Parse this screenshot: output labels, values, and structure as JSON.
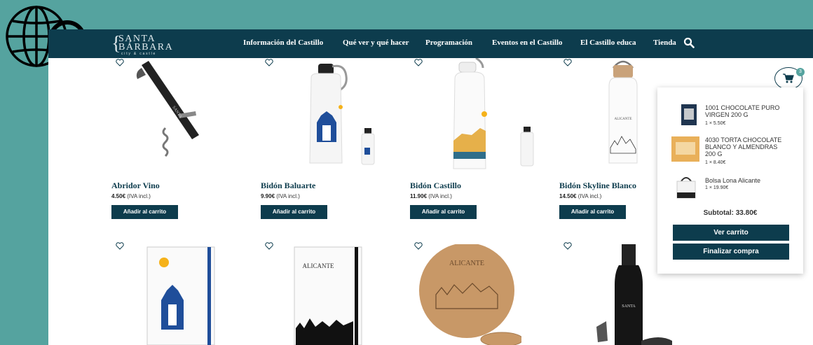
{
  "nav": {
    "logo": {
      "line1": "SANTA",
      "line2": "BÁRBARA",
      "line3": "city & castle"
    },
    "items": [
      "Información del Castillo",
      "Qué ver y qué hacer",
      "Programación",
      "Eventos en el Castillo",
      "El Castillo educa",
      "Tienda"
    ]
  },
  "products": [
    {
      "name": "Abridor Vino",
      "price": "4.50€",
      "tax": "(IVA incl.)",
      "button": "Añadir al carrito"
    },
    {
      "name": "Bidón Baluarte",
      "price": "9.90€",
      "tax": "(IVA incl.)",
      "button": "Añadir al carrito"
    },
    {
      "name": "Bidón Castillo",
      "price": "11.90€",
      "tax": "(IVA incl.)",
      "button": "Añadir al carrito"
    },
    {
      "name": "Bidón Skyline Blanco",
      "price": "14.50€",
      "tax": "(IVA incl.)",
      "button": "Añadir al carrito"
    }
  ],
  "product_images": {
    "notebook_label": "ALICANTE",
    "coaster_label": "ALICANTE"
  },
  "cart": {
    "count": "3",
    "items": [
      {
        "name": "1001 CHOCOLATE PURO VIRGEN 200 G",
        "qty": "1 × 5.50€"
      },
      {
        "name": "4030 TORTA CHOCOLATE BLANCO Y ALMENDRAS 200 G",
        "qty": "1 × 8.40€"
      },
      {
        "name": "Bolsa Lona Alicante",
        "qty": "1 × 19.90€"
      }
    ],
    "subtotal": "Subtotal: 33.80€",
    "view_cart": "Ver carrito",
    "checkout": "Finalizar compra"
  },
  "colors": {
    "brand": "#0d3c4d",
    "page_bg": "#55a39f"
  }
}
